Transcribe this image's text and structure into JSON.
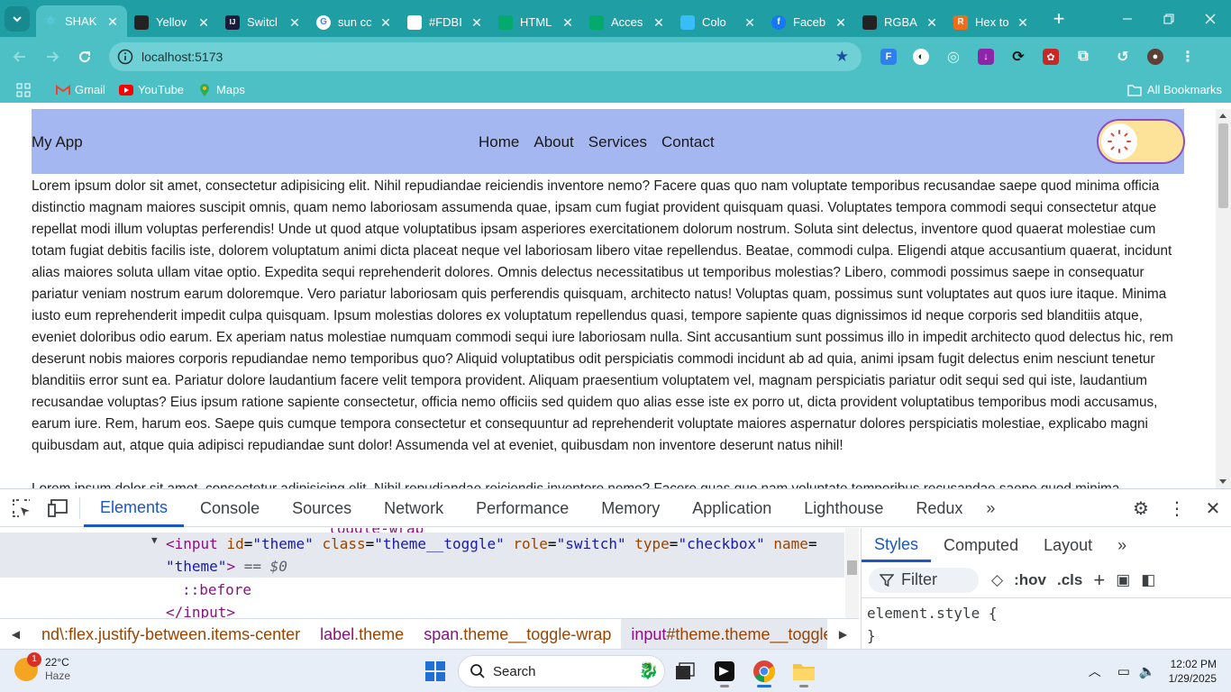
{
  "browser": {
    "tabs": [
      {
        "title": "SHAK",
        "favicon": "react-icon",
        "color": "#61dafb",
        "active": true
      },
      {
        "title": "Yellov",
        "favicon": "mask-icon",
        "color": "#222222"
      },
      {
        "title": "Switcl",
        "favicon": "ij-icon",
        "color": "#1b1b3a"
      },
      {
        "title": "sun cc",
        "favicon": "google-icon",
        "color": "#ffffff"
      },
      {
        "title": "#FDBI",
        "favicon": "flask-icon",
        "color": "#ffffff"
      },
      {
        "title": "HTML",
        "favicon": "w3-icon",
        "color": "#04aa6d"
      },
      {
        "title": "Acces",
        "favicon": "w3-icon",
        "color": "#04aa6d"
      },
      {
        "title": "Colo",
        "favicon": "tailwind-icon",
        "color": "#38bdf8"
      },
      {
        "title": "Faceb",
        "favicon": "facebook-icon",
        "color": "#1877f2"
      },
      {
        "title": "RGBA",
        "favicon": "pen-icon",
        "color": "#222222"
      },
      {
        "title": "Hex to",
        "favicon": "r-icon",
        "color": "#f26c1a"
      }
    ],
    "address": "localhost:5173",
    "bookmarks": [
      {
        "label": "Gmail",
        "icon": "gmail-icon"
      },
      {
        "label": "YouTube",
        "icon": "youtube-icon"
      },
      {
        "label": "Maps",
        "icon": "maps-icon"
      }
    ],
    "all_bookmarks": "All Bookmarks"
  },
  "app": {
    "title": "My App",
    "nav": [
      "Home",
      "About",
      "Services",
      "Contact"
    ],
    "paragraph": "Lorem ipsum dolor sit amet, consectetur adipisicing elit. Nihil repudiandae reiciendis inventore nemo? Facere quas quo nam voluptate temporibus recusandae saepe quod minima officia distinctio magnam maiores suscipit omnis, quam nemo laboriosam assumenda quae, ipsam cum fugiat provident quisquam quasi. Voluptates tempora commodi sequi consectetur atque repellat modi illum voluptas perferendis! Unde ut quod atque voluptatibus ipsam asperiores exercitationem dolorum nostrum. Soluta sint delectus, inventore quod quaerat molestiae cum totam fugiat debitis facilis iste, dolorem voluptatum animi dicta placeat neque vel laboriosam libero vitae repellendus. Beatae, commodi culpa. Eligendi atque accusantium quaerat, incidunt alias maiores soluta ullam vitae optio. Expedita sequi reprehenderit dolores. Omnis delectus necessitatibus ut temporibus molestias? Libero, commodi possimus saepe in consequatur pariatur veniam nostrum earum doloremque. Vero pariatur laboriosam quis perferendis quisquam, architecto natus! Voluptas quam, possimus sunt voluptates aut quos iure itaque. Minima iusto eum reprehenderit impedit culpa quisquam. Ipsum molestias dolores ex voluptatum repellendus quasi, tempore sapiente quas dignissimos id neque corporis sed blanditiis atque, eveniet doloribus odio earum. Ex aperiam natus molestiae numquam commodi sequi iure laboriosam nulla. Sint accusantium sunt possimus illo in impedit architecto quod delectus hic, rem deserunt nobis maiores corporis repudiandae nemo temporibus quo? Aliquid voluptatibus odit perspiciatis commodi incidunt ab ad quia, animi ipsam fugit delectus enim nesciunt tenetur blanditiis error sunt ea. Pariatur dolore laudantium facere velit tempora provident. Aliquam praesentium voluptatem vel, magnam perspiciatis pariatur odit sequi sed qui iste, laudantium recusandae voluptas? Eius ipsum ratione sapiente consectetur, officia nemo officiis sed quidem quo alias esse iste ex porro ut, dicta provident voluptatibus temporibus modi accusamus, earum iure. Rem, harum eos. Saepe quis cumque tempora consectetur et consequuntur ad reprehenderit voluptate maiores aspernatur dolores perspiciatis molestiae, explicabo magni quibusdam aut, atque quia adipisci repudiandae sunt dolor! Assumenda vel at eveniet, quibusdam non inventore deserunt natus nihil!",
    "paragraph2": "Lorem ipsum dolor sit amet, consectetur adipisicing elit. Nihil repudiandae reiciendis inventore nemo? Facere quas quo nam voluptate temporibus recusandae saepe quod minima"
  },
  "devtools": {
    "tabs": [
      "Elements",
      "Console",
      "Sources",
      "Network",
      "Performance",
      "Memory",
      "Application",
      "Lighthouse",
      "Redux"
    ],
    "more": "»",
    "dom": {
      "tag": "input",
      "attrs": [
        {
          "name": "id",
          "value": "\"theme\""
        },
        {
          "name": "class",
          "value": "\"theme__toggle\""
        },
        {
          "name": "role",
          "value": "\"switch\""
        },
        {
          "name": "type",
          "value": "\"checkbox\""
        },
        {
          "name": "name",
          "value": "="
        }
      ],
      "name_value": "\"theme\"",
      "eq_marker": "== $0",
      "pseudo": "::before",
      "close": "</input>"
    },
    "styles_tabs": [
      "Styles",
      "Computed",
      "Layout"
    ],
    "filter_placeholder": "Filter",
    "hov": ":hov",
    "cls": ".cls",
    "element_style_open": "element.style {",
    "element_style_close": "}",
    "breadcrumbs": [
      {
        "tag": "",
        "cls": "nd\\:flex.justify-between.items-center"
      },
      {
        "tag": "label",
        "cls": ".theme"
      },
      {
        "tag": "span",
        "cls": ".theme__toggle-wrap"
      },
      {
        "tag": "input",
        "cls": "#theme.theme__toggle",
        "active": true
      }
    ]
  },
  "taskbar": {
    "weather_temp": "22°C",
    "weather_desc": "Haze",
    "weather_badge": "1",
    "search_label": "Search",
    "time": "12:02 PM",
    "date": "1/29/2025"
  }
}
